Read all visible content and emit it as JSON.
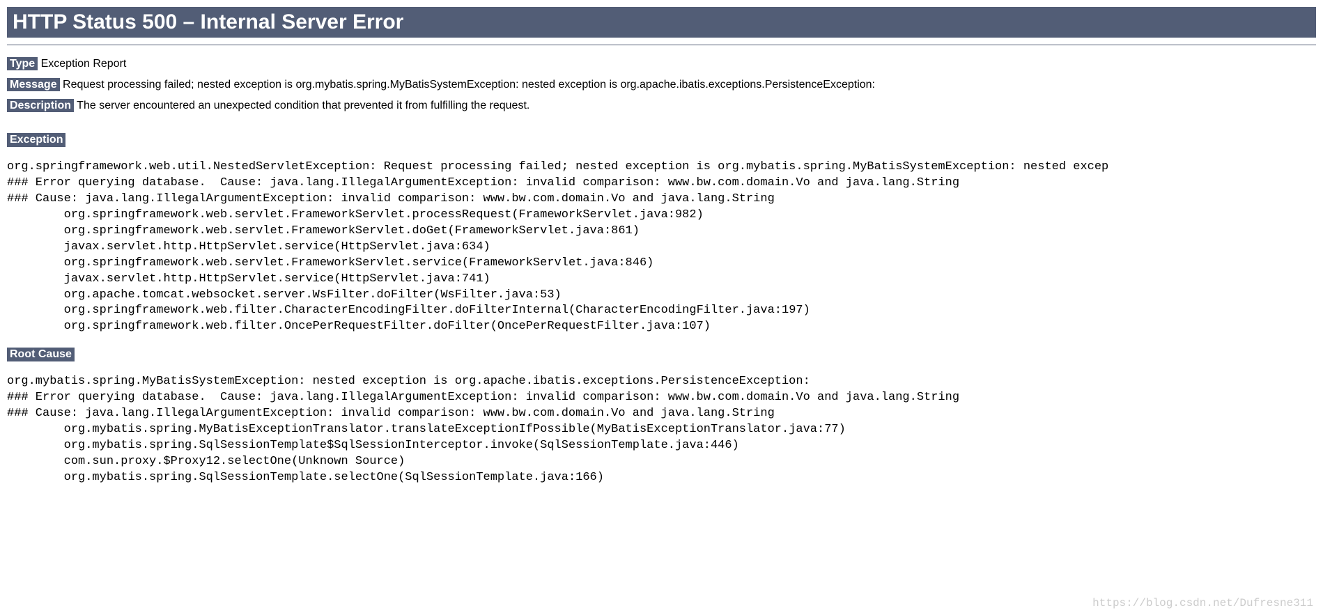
{
  "header": {
    "title": "HTTP Status 500 – Internal Server Error"
  },
  "type": {
    "label": "Type",
    "value": "Exception Report"
  },
  "message": {
    "label": "Message",
    "value": "Request processing failed; nested exception is org.mybatis.spring.MyBatisSystemException: nested exception is org.apache.ibatis.exceptions.PersistenceException:"
  },
  "description": {
    "label": "Description",
    "value": "The server encountered an unexpected condition that prevented it from fulfilling the request."
  },
  "exception": {
    "label": "Exception",
    "trace": "org.springframework.web.util.NestedServletException: Request processing failed; nested exception is org.mybatis.spring.MyBatisSystemException: nested excep\n### Error querying database.  Cause: java.lang.IllegalArgumentException: invalid comparison: www.bw.com.domain.Vo and java.lang.String\n### Cause: java.lang.IllegalArgumentException: invalid comparison: www.bw.com.domain.Vo and java.lang.String\n\torg.springframework.web.servlet.FrameworkServlet.processRequest(FrameworkServlet.java:982)\n\torg.springframework.web.servlet.FrameworkServlet.doGet(FrameworkServlet.java:861)\n\tjavax.servlet.http.HttpServlet.service(HttpServlet.java:634)\n\torg.springframework.web.servlet.FrameworkServlet.service(FrameworkServlet.java:846)\n\tjavax.servlet.http.HttpServlet.service(HttpServlet.java:741)\n\torg.apache.tomcat.websocket.server.WsFilter.doFilter(WsFilter.java:53)\n\torg.springframework.web.filter.CharacterEncodingFilter.doFilterInternal(CharacterEncodingFilter.java:197)\n\torg.springframework.web.filter.OncePerRequestFilter.doFilter(OncePerRequestFilter.java:107)"
  },
  "rootcause": {
    "label": "Root Cause",
    "trace": "org.mybatis.spring.MyBatisSystemException: nested exception is org.apache.ibatis.exceptions.PersistenceException: \n### Error querying database.  Cause: java.lang.IllegalArgumentException: invalid comparison: www.bw.com.domain.Vo and java.lang.String\n### Cause: java.lang.IllegalArgumentException: invalid comparison: www.bw.com.domain.Vo and java.lang.String\n\torg.mybatis.spring.MyBatisExceptionTranslator.translateExceptionIfPossible(MyBatisExceptionTranslator.java:77)\n\torg.mybatis.spring.SqlSessionTemplate$SqlSessionInterceptor.invoke(SqlSessionTemplate.java:446)\n\tcom.sun.proxy.$Proxy12.selectOne(Unknown Source)\n\torg.mybatis.spring.SqlSessionTemplate.selectOne(SqlSessionTemplate.java:166)"
  },
  "watermark": "https://blog.csdn.net/Dufresne311"
}
